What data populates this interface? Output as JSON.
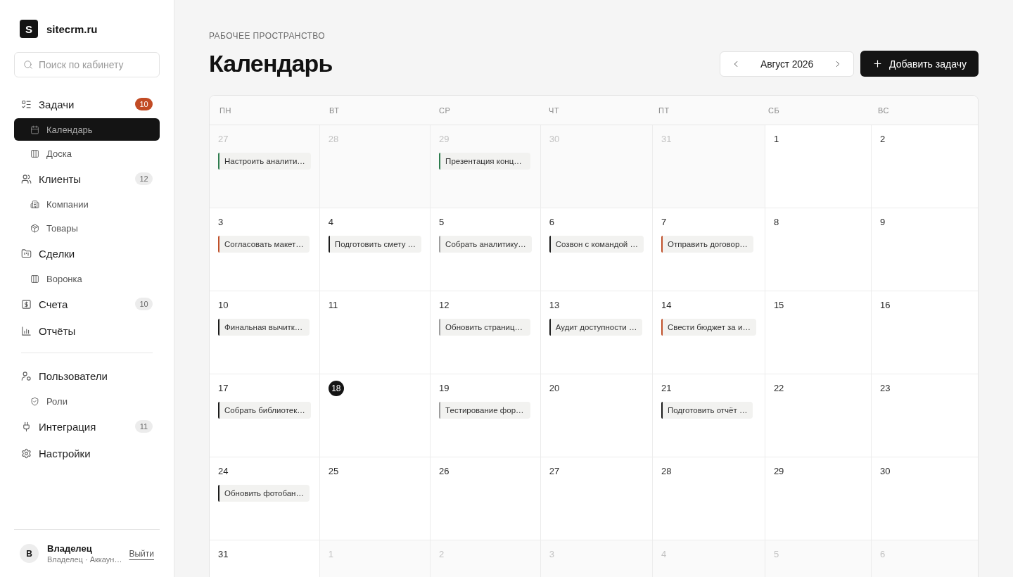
{
  "brand": {
    "logo_letter": "S",
    "name": "sitecrm.ru"
  },
  "search": {
    "placeholder": "Поиск по кабинету"
  },
  "nav": {
    "groups": [
      {
        "items": [
          {
            "label": "Задачи",
            "selected": false,
            "badge": {
              "text": "10",
              "highlighted": true
            },
            "children": [
              {
                "label": "Календарь",
                "selected": true
              },
              {
                "label": "Доска",
                "selected": false
              }
            ]
          },
          {
            "label": "Клиенты",
            "selected": false,
            "badge": {
              "text": "12",
              "highlighted": false
            },
            "children": [
              {
                "label": "Компании",
                "selected": false
              },
              {
                "label": "Товары",
                "selected": false
              }
            ]
          },
          {
            "label": "Сделки",
            "selected": false,
            "children": [
              {
                "label": "Воронка",
                "selected": false
              }
            ]
          },
          {
            "label": "Счета",
            "selected": false,
            "badge": {
              "text": "10",
              "highlighted": false
            }
          },
          {
            "label": "Отчёты",
            "selected": false
          }
        ]
      },
      {
        "items": [
          {
            "label": "Пользователи",
            "selected": false,
            "children": [
              {
                "label": "Роли",
                "selected": false
              }
            ]
          },
          {
            "label": "Интеграция",
            "selected": false,
            "badge": {
              "text": "11",
              "highlighted": false
            }
          },
          {
            "label": "Настройки",
            "selected": false
          }
        ]
      }
    ]
  },
  "user": {
    "avatar_letter": "В",
    "name": "Владелец",
    "subtitle": "Владелец · Аккаун…",
    "logout": "Выйти"
  },
  "header": {
    "eyebrow": "РАБОЧЕЕ ПРОСТРАНСТВО",
    "title": "Календарь",
    "month": "Август 2026",
    "add_button": "Добавить задачу"
  },
  "calendar": {
    "weekdays": [
      "ПН",
      "ВТ",
      "СР",
      "ЧТ",
      "ПТ",
      "СБ",
      "ВС"
    ],
    "weeks": [
      [
        {
          "day": "27",
          "outside": true,
          "today": false,
          "events": [
            {
              "title": "Настроить аналити…",
              "color": "#2e7d4f"
            }
          ]
        },
        {
          "day": "28",
          "outside": true,
          "today": false
        },
        {
          "day": "29",
          "outside": true,
          "today": false,
          "events": [
            {
              "title": "Презентация конц…",
              "color": "#2e7d4f"
            }
          ]
        },
        {
          "day": "30",
          "outside": true,
          "today": false
        },
        {
          "day": "31",
          "outside": true,
          "today": false
        },
        {
          "day": "1",
          "outside": false,
          "today": false
        },
        {
          "day": "2",
          "outside": false,
          "today": false
        }
      ],
      [
        {
          "day": "3",
          "outside": false,
          "today": false,
          "events": [
            {
              "title": "Согласовать макет…",
              "color": "#c0502a"
            }
          ]
        },
        {
          "day": "4",
          "outside": false,
          "today": false,
          "events": [
            {
              "title": "Подготовить смету …",
              "color": "#1b1b1b"
            }
          ]
        },
        {
          "day": "5",
          "outside": false,
          "today": false,
          "events": [
            {
              "title": "Собрать аналитику…",
              "color": "#9e9e9e"
            }
          ]
        },
        {
          "day": "6",
          "outside": false,
          "today": false,
          "events": [
            {
              "title": "Созвон с командой …",
              "color": "#1b1b1b"
            }
          ]
        },
        {
          "day": "7",
          "outside": false,
          "today": false,
          "events": [
            {
              "title": "Отправить договор…",
              "color": "#c0502a"
            }
          ]
        },
        {
          "day": "8",
          "outside": false,
          "today": false
        },
        {
          "day": "9",
          "outside": false,
          "today": false
        }
      ],
      [
        {
          "day": "10",
          "outside": false,
          "today": false,
          "events": [
            {
              "title": "Финальная вычитк…",
              "color": "#1b1b1b"
            }
          ]
        },
        {
          "day": "11",
          "outside": false,
          "today": false
        },
        {
          "day": "12",
          "outside": false,
          "today": false,
          "events": [
            {
              "title": "Обновить страниц…",
              "color": "#9e9e9e"
            }
          ]
        },
        {
          "day": "13",
          "outside": false,
          "today": false,
          "events": [
            {
              "title": "Аудит доступности …",
              "color": "#1b1b1b"
            }
          ]
        },
        {
          "day": "14",
          "outside": false,
          "today": false,
          "events": [
            {
              "title": "Свести бюджет за и…",
              "color": "#c0502a"
            }
          ]
        },
        {
          "day": "15",
          "outside": false,
          "today": false
        },
        {
          "day": "16",
          "outside": false,
          "today": false
        }
      ],
      [
        {
          "day": "17",
          "outside": false,
          "today": false,
          "events": [
            {
              "title": "Собрать библиотек…",
              "color": "#1b1b1b"
            }
          ]
        },
        {
          "day": "18",
          "outside": false,
          "today": true
        },
        {
          "day": "19",
          "outside": false,
          "today": false,
          "events": [
            {
              "title": "Тестирование фор…",
              "color": "#9e9e9e"
            }
          ]
        },
        {
          "day": "20",
          "outside": false,
          "today": false
        },
        {
          "day": "21",
          "outside": false,
          "today": false,
          "events": [
            {
              "title": "Подготовить отчёт …",
              "color": "#1b1b1b"
            }
          ]
        },
        {
          "day": "22",
          "outside": false,
          "today": false
        },
        {
          "day": "23",
          "outside": false,
          "today": false
        }
      ],
      [
        {
          "day": "24",
          "outside": false,
          "today": false,
          "events": [
            {
              "title": "Обновить фотобан…",
              "color": "#1b1b1b"
            }
          ]
        },
        {
          "day": "25",
          "outside": false,
          "today": false
        },
        {
          "day": "26",
          "outside": false,
          "today": false
        },
        {
          "day": "27",
          "outside": false,
          "today": false
        },
        {
          "day": "28",
          "outside": false,
          "today": false
        },
        {
          "day": "29",
          "outside": false,
          "today": false
        },
        {
          "day": "30",
          "outside": false,
          "today": false
        }
      ],
      [
        {
          "day": "31",
          "outside": false,
          "today": false
        },
        {
          "day": "1",
          "outside": true,
          "today": false
        },
        {
          "day": "2",
          "outside": true,
          "today": false
        },
        {
          "day": "3",
          "outside": true,
          "today": false
        },
        {
          "day": "4",
          "outside": true,
          "today": false
        },
        {
          "day": "5",
          "outside": true,
          "today": false
        },
        {
          "day": "6",
          "outside": true,
          "today": false
        }
      ]
    ]
  }
}
